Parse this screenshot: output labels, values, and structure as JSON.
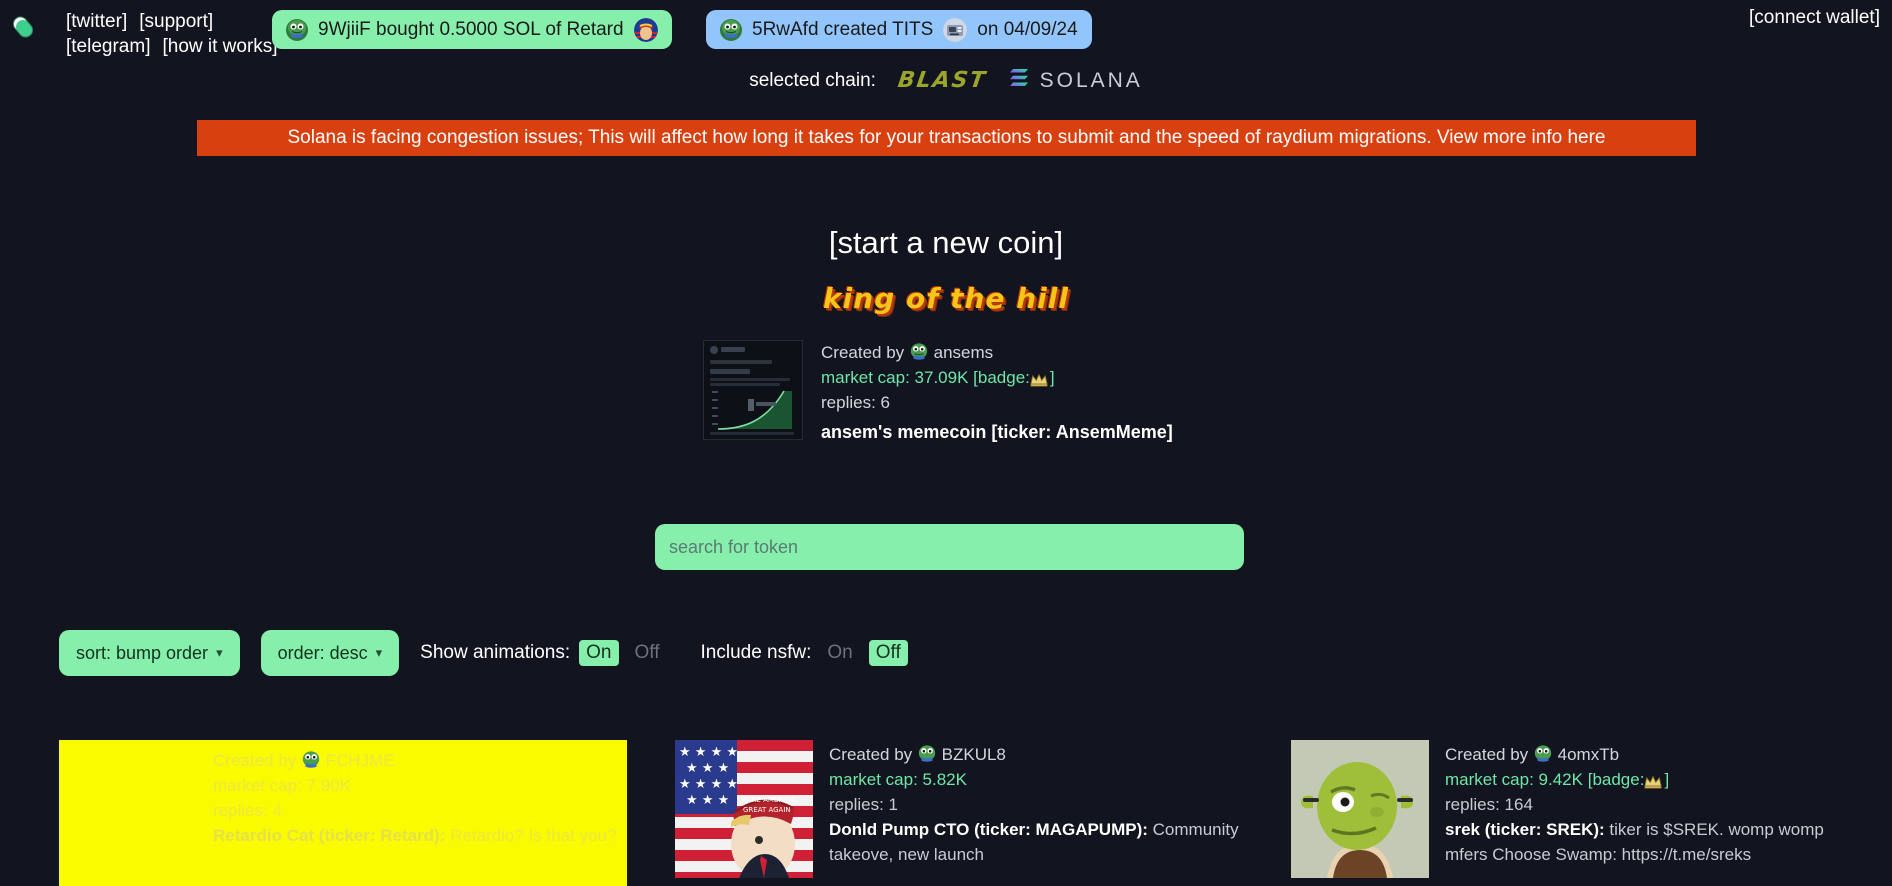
{
  "nav": {
    "links": [
      "[twitter]",
      "[support]",
      "[telegram]",
      "[how it works]"
    ],
    "connect_wallet": "[connect wallet]",
    "logo_icon": "pill-icon"
  },
  "toasts": [
    {
      "id": "buy",
      "text": "9WjiiF  bought 0.5000 SOL of Retard",
      "bg": "#86efac",
      "avatar_icon": "pepe-avatar-icon",
      "coin_icon": "trump-coin-icon"
    },
    {
      "id": "create",
      "text": "5RwAfd created TITS",
      "date_text": "on 04/09/24",
      "bg": "#93c5fd",
      "avatar_icon": "pepe-avatar-icon",
      "coin_icon": "tits-coin-icon"
    }
  ],
  "chain": {
    "label": "selected chain:",
    "blast": "BLAST",
    "solana": "SOLANA",
    "solana_icon": "solana-logo-icon"
  },
  "alert": {
    "text": "Solana is facing congestion issues; This will affect how long it takes for your transactions to submit and the speed of raydium migrations. View more info here",
    "bg": "#d9400f"
  },
  "hero": {
    "start_coin": "[start a new coin]",
    "king_of_the_hill": "king of the hill"
  },
  "king_coin": {
    "created_by_label": "Created by",
    "creator": "ansems",
    "market_cap_label": "market cap:",
    "market_cap": "37.09K",
    "badge_label": "[badge:",
    "badge_close": "]",
    "badge_icon": "crown-icon",
    "replies_label": "replies:",
    "replies": "6",
    "title": "ansem's memecoin [ticker: AnsemMeme]",
    "thumb_icon": "chart-thumbnail-icon"
  },
  "search": {
    "placeholder": "search for token",
    "value": ""
  },
  "filters": {
    "sort_label": "sort: bump order",
    "order_label": "order: desc",
    "caret_icon": "chevron-down-icon",
    "show_animations": {
      "label": "Show animations:",
      "on": "On",
      "off": "Off",
      "selected": "On"
    },
    "include_nsfw": {
      "label": "Include nsfw:",
      "on": "On",
      "off": "Off",
      "selected": "Off"
    }
  },
  "coins": [
    {
      "created_by_label": "Created by",
      "creator": "FCHJME",
      "market_cap_label": "market cap:",
      "market_cap": "7.90K",
      "has_badge": false,
      "replies_label": "replies:",
      "replies": "4",
      "name_ticker": "Retardio Cat (ticker: Retard):",
      "description": "Retardio? Is that you?",
      "image_icon": "retardio-cat-icon",
      "hovered": true
    },
    {
      "created_by_label": "Created by",
      "creator": "BZKUL8",
      "market_cap_label": "market cap:",
      "market_cap": "5.82K",
      "has_badge": false,
      "replies_label": "replies:",
      "replies": "1",
      "name_ticker": "Donld Pump CTO (ticker: MAGAPUMP):",
      "description": "Community takeove, new launch",
      "image_icon": "trump-flag-icon",
      "hovered": false
    },
    {
      "created_by_label": "Created by",
      "creator": "4omxTb",
      "market_cap_label": "market cap:",
      "market_cap": "9.42K",
      "has_badge": true,
      "badge_label": "[badge:",
      "badge_close": "]",
      "replies_label": "replies:",
      "replies": "164",
      "name_ticker": "srek (ticker: SREK):",
      "description": "tiker is $SREK. womp womp mfers Choose Swamp: https://t.me/sreks",
      "image_icon": "shrek-icon",
      "hovered": false
    }
  ],
  "colors": {
    "page_bg": "#12141f",
    "accent_green": "#86efac",
    "accent_blue": "#93c5fd",
    "alert_red": "#d9400f",
    "hover_yellow": "#fbfb00",
    "mcap_green": "#6ee7a8"
  }
}
